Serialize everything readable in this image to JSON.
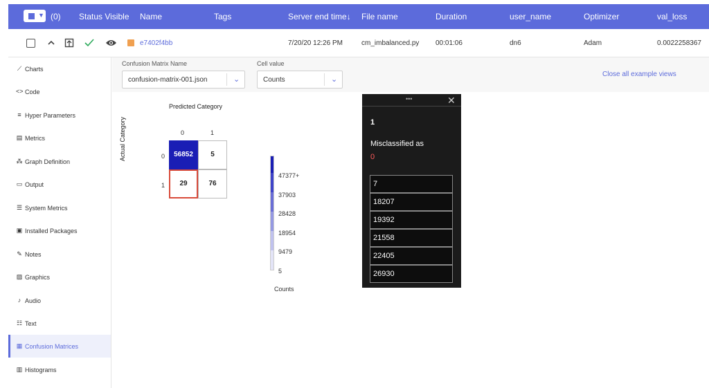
{
  "header": {
    "count": "(0)",
    "columns": [
      "Status Visible",
      "Name",
      "Tags",
      "Server end time↓",
      "File name",
      "Duration",
      "user_name",
      "Optimizer",
      "val_loss"
    ]
  },
  "row": {
    "name": "e7402f4bb",
    "server_end_time": "7/20/20 12:26 PM",
    "file_name": "cm_imbalanced.py",
    "duration": "00:01:06",
    "user_name": "dn6",
    "optimizer": "Adam",
    "val_loss": "0.0022258367"
  },
  "sidebar": {
    "items": [
      {
        "label": "Charts",
        "icon": "chart-line-icon"
      },
      {
        "label": "Code",
        "icon": "code-icon"
      },
      {
        "label": "Hyper Parameters",
        "icon": "list-icon"
      },
      {
        "label": "Metrics",
        "icon": "table-icon"
      },
      {
        "label": "Graph Definition",
        "icon": "graph-icon"
      },
      {
        "label": "Output",
        "icon": "monitor-icon"
      },
      {
        "label": "System Metrics",
        "icon": "server-icon"
      },
      {
        "label": "Installed Packages",
        "icon": "package-icon"
      },
      {
        "label": "Notes",
        "icon": "pencil-icon"
      },
      {
        "label": "Graphics",
        "icon": "image-icon"
      },
      {
        "label": "Audio",
        "icon": "music-note-icon"
      },
      {
        "label": "Text",
        "icon": "text-icon"
      },
      {
        "label": "Confusion Matrices",
        "icon": "grid-icon",
        "active": true
      },
      {
        "label": "Histograms",
        "icon": "histogram-icon"
      }
    ]
  },
  "toolbar": {
    "cm_name_label": "Confusion Matrix Name",
    "cm_name_value": "confusion-matrix-001.json",
    "cell_value_label": "Cell value",
    "cell_value_value": "Counts",
    "close_all": "Close all example views"
  },
  "matrix": {
    "predicted_title": "Predicted Category",
    "actual_title": "Actual Category",
    "col_labels": [
      "0",
      "1"
    ],
    "row_labels": [
      "0",
      "1"
    ],
    "cells": [
      "56852",
      "5",
      "29",
      "76"
    ]
  },
  "legend": {
    "labels": [
      "47377+",
      "37903",
      "28428",
      "18954",
      "9479",
      "5"
    ],
    "title": "Counts",
    "colors": [
      "#1a1eb5",
      "#3f44c9",
      "#6a6ed6",
      "#9599e2",
      "#c0c2ee",
      "#e3e4f7",
      "#ffffff"
    ]
  },
  "popup": {
    "number": "1",
    "misclassified_label": "Misclassified as",
    "misclassified_value": "0",
    "items": [
      "7",
      "18207",
      "19392",
      "21558",
      "22405",
      "26930"
    ]
  },
  "colors": {
    "accent": "#5c6bdb",
    "highlight": "#d84a3a",
    "warning": "#ff5b5b"
  }
}
